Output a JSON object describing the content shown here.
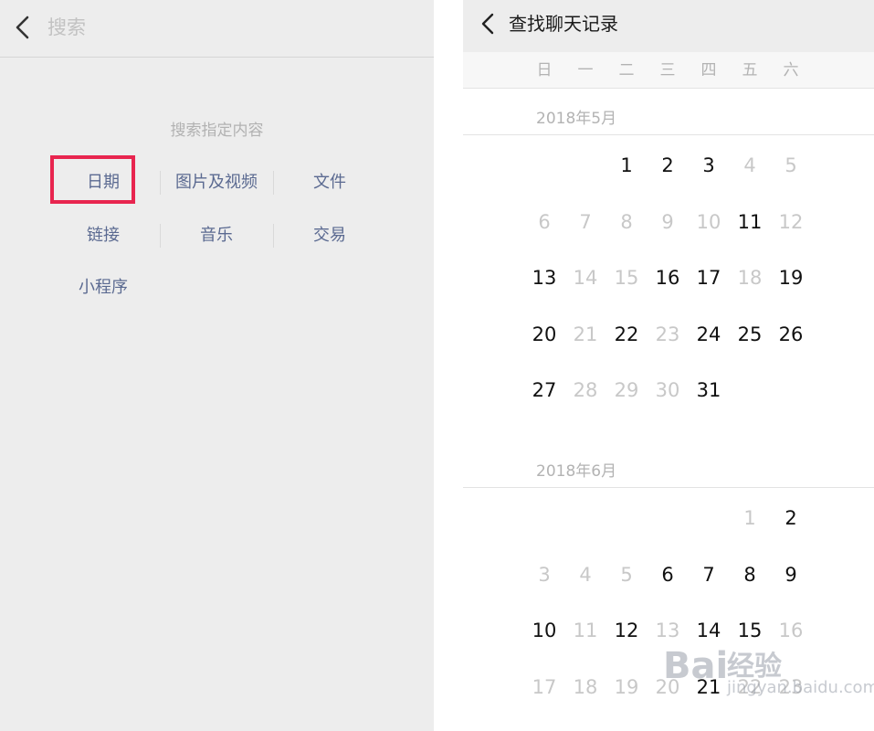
{
  "left": {
    "search": {
      "placeholder": "搜索",
      "value": ""
    },
    "hint": "搜索指定内容",
    "categories": [
      "日期",
      "图片及视频",
      "文件",
      "链接",
      "音乐",
      "交易",
      "小程序"
    ]
  },
  "right": {
    "title": "查找聊天记录",
    "weekdays": [
      "日",
      "一",
      "二",
      "三",
      "四",
      "五",
      "六"
    ],
    "months": [
      {
        "label": "2018年5月",
        "first_weekday": 2,
        "days": [
          {
            "d": 1,
            "on": true
          },
          {
            "d": 2,
            "on": true
          },
          {
            "d": 3,
            "on": true
          },
          {
            "d": 4,
            "on": false
          },
          {
            "d": 5,
            "on": false
          },
          {
            "d": 6,
            "on": false
          },
          {
            "d": 7,
            "on": false
          },
          {
            "d": 8,
            "on": false
          },
          {
            "d": 9,
            "on": false
          },
          {
            "d": 10,
            "on": false
          },
          {
            "d": 11,
            "on": true
          },
          {
            "d": 12,
            "on": false
          },
          {
            "d": 13,
            "on": true
          },
          {
            "d": 14,
            "on": false
          },
          {
            "d": 15,
            "on": false
          },
          {
            "d": 16,
            "on": true
          },
          {
            "d": 17,
            "on": true
          },
          {
            "d": 18,
            "on": false
          },
          {
            "d": 19,
            "on": true
          },
          {
            "d": 20,
            "on": true
          },
          {
            "d": 21,
            "on": false
          },
          {
            "d": 22,
            "on": true
          },
          {
            "d": 23,
            "on": false
          },
          {
            "d": 24,
            "on": true
          },
          {
            "d": 25,
            "on": true
          },
          {
            "d": 26,
            "on": true
          },
          {
            "d": 27,
            "on": true
          },
          {
            "d": 28,
            "on": false
          },
          {
            "d": 29,
            "on": false
          },
          {
            "d": 30,
            "on": false
          },
          {
            "d": 31,
            "on": true
          }
        ]
      },
      {
        "label": "2018年6月",
        "first_weekday": 5,
        "days": [
          {
            "d": 1,
            "on": false
          },
          {
            "d": 2,
            "on": true
          },
          {
            "d": 3,
            "on": false
          },
          {
            "d": 4,
            "on": false
          },
          {
            "d": 5,
            "on": false
          },
          {
            "d": 6,
            "on": true
          },
          {
            "d": 7,
            "on": true
          },
          {
            "d": 8,
            "on": true
          },
          {
            "d": 9,
            "on": true
          },
          {
            "d": 10,
            "on": true
          },
          {
            "d": 11,
            "on": false
          },
          {
            "d": 12,
            "on": true
          },
          {
            "d": 13,
            "on": false
          },
          {
            "d": 14,
            "on": true
          },
          {
            "d": 15,
            "on": true
          },
          {
            "d": 16,
            "on": false
          },
          {
            "d": 17,
            "on": false
          },
          {
            "d": 18,
            "on": false
          },
          {
            "d": 19,
            "on": false
          },
          {
            "d": 20,
            "on": false
          },
          {
            "d": 21,
            "on": true
          },
          {
            "d": 22,
            "on": false
          },
          {
            "d": 23,
            "on": false
          }
        ]
      }
    ]
  },
  "watermark": {
    "brand": "Bai",
    "name": "经验",
    "url": "jingyan.baidu.com"
  },
  "colors": {
    "highlight": "#e8254f",
    "link": "#5b6a91",
    "disabled": "#c8c8c8"
  }
}
